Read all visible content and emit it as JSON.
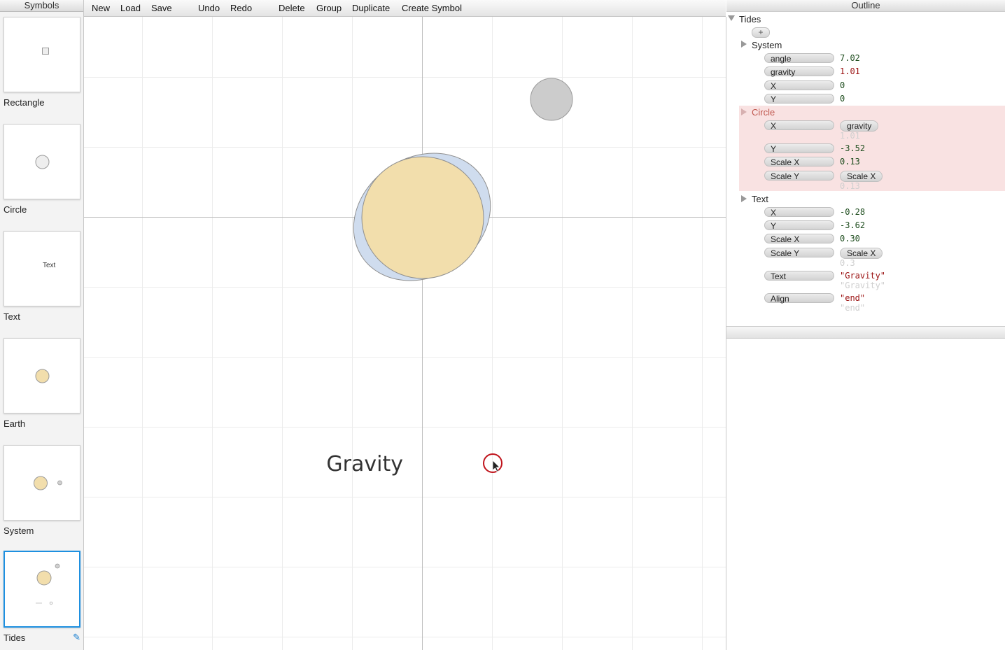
{
  "symbols_panel": {
    "title": "Symbols",
    "items": [
      {
        "label": "Rectangle"
      },
      {
        "label": "Circle"
      },
      {
        "label": "Text",
        "thumb_text": "Text"
      },
      {
        "label": "Earth"
      },
      {
        "label": "System"
      },
      {
        "label": "Tides",
        "selected": true
      }
    ]
  },
  "toolbar": {
    "new": "New",
    "load": "Load",
    "save": "Save",
    "undo": "Undo",
    "redo": "Redo",
    "delete": "Delete",
    "group": "Group",
    "duplicate": "Duplicate",
    "create_symbol": "Create Symbol"
  },
  "canvas": {
    "text_object": "Gravity"
  },
  "outline": {
    "title": "Outline",
    "root": "Tides",
    "add_label": "+",
    "system": {
      "name": "System",
      "props": [
        {
          "name": "angle",
          "value": "7.02"
        },
        {
          "name": "gravity",
          "value": "1.01"
        },
        {
          "name": "X",
          "value": "0"
        },
        {
          "name": "Y",
          "value": "0"
        }
      ]
    },
    "circle": {
      "name": "Circle",
      "x_label": "X",
      "x_ref": "gravity",
      "x_ref_value": "1.01",
      "y_label": "Y",
      "y_value": "-3.52",
      "scalex_label": "Scale X",
      "scalex_value": "0.13",
      "scaley_label": "Scale Y",
      "scaley_ref": "Scale X",
      "scaley_ref_value": "0.13"
    },
    "text": {
      "name": "Text",
      "x_label": "X",
      "x_value": "-0.28",
      "y_label": "Y",
      "y_value": "-3.62",
      "scalex_label": "Scale X",
      "scalex_value": "0.30",
      "scaley_label": "Scale Y",
      "scaley_ref": "Scale X",
      "scaley_ref_value": "0.3",
      "text_label": "Text",
      "text_value": "\"Gravity\"",
      "text_computed": "\"Gravity\"",
      "align_label": "Align",
      "align_value": "\"end\"",
      "align_computed": "\"end\""
    }
  },
  "colors": {
    "accent": "#1e90e0",
    "earth_fill": "#f2deac",
    "orbit_fill": "#cfdcee",
    "circle_highlight": "#f9e2e2",
    "cursor_ring": "#c0141c"
  }
}
